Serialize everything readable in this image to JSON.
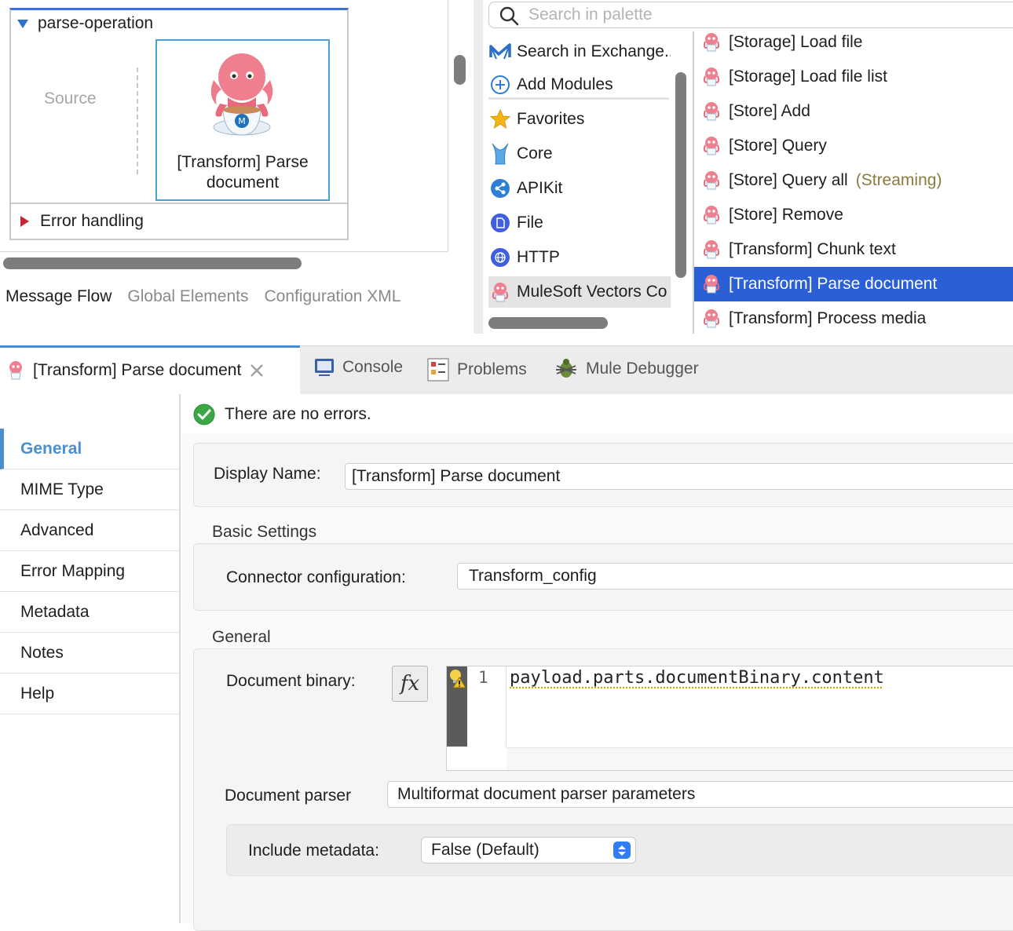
{
  "canvas": {
    "flow_title": "parse-operation",
    "source_label": "Source",
    "component_label": "[Transform] Parse document",
    "error_handling_label": "Error handling",
    "editor_tabs": [
      "Message Flow",
      "Global Elements",
      "Configuration XML"
    ]
  },
  "palette": {
    "search_placeholder": "Search in palette",
    "categories": [
      {
        "label": "Search in Exchange...",
        "icon": "exchange-icon"
      },
      {
        "label": "Add Modules",
        "icon": "add-circle-icon"
      },
      {
        "label": "Favorites",
        "icon": "star-icon"
      },
      {
        "label": "Core",
        "icon": "core-icon"
      },
      {
        "label": "APIKit",
        "icon": "apikit-icon"
      },
      {
        "label": "File",
        "icon": "file-icon"
      },
      {
        "label": "HTTP",
        "icon": "http-icon"
      },
      {
        "label": "MuleSoft Vectors Co",
        "icon": "octopus-icon"
      }
    ],
    "operations": [
      {
        "label": "[Storage] Load file",
        "note": ""
      },
      {
        "label": "[Storage] Load file list",
        "note": ""
      },
      {
        "label": "[Store] Add",
        "note": ""
      },
      {
        "label": "[Store] Query",
        "note": ""
      },
      {
        "label": "[Store] Query all",
        "note": "(Streaming)"
      },
      {
        "label": "[Store] Remove",
        "note": ""
      },
      {
        "label": "[Transform] Chunk text",
        "note": ""
      },
      {
        "label": "[Transform] Parse document",
        "note": ""
      },
      {
        "label": "[Transform] Process media",
        "note": ""
      }
    ]
  },
  "bottom_tabs": {
    "active": "[Transform] Parse document",
    "console": "Console",
    "problems": "Problems",
    "debugger": "Mule Debugger"
  },
  "properties": {
    "nav": [
      "General",
      "MIME Type",
      "Advanced",
      "Error Mapping",
      "Metadata",
      "Notes",
      "Help"
    ],
    "status": "There are no errors.",
    "display_name_label": "Display Name:",
    "display_name_value": "[Transform] Parse document",
    "basic_settings_title": "Basic Settings",
    "connector_config_label": "Connector configuration:",
    "connector_config_value": "Transform_config",
    "general_title": "General",
    "document_binary_label": "Document binary:",
    "fx_label": "fx",
    "code_line_number": "1",
    "code_value": "payload.parts.documentBinary.content",
    "document_parser_label": "Document parser",
    "document_parser_value": "Multiformat document parser parameters",
    "include_metadata_label": "Include metadata:",
    "include_metadata_value": "False (Default)"
  },
  "colors": {
    "accent": "#2a5fd6",
    "nav_active": "#4b8fd0",
    "select_arrows": "#2f7ff3",
    "ok_green": "#3aa845"
  }
}
